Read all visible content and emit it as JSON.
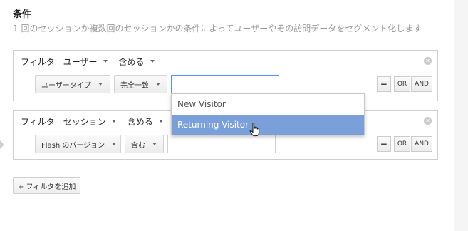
{
  "section": {
    "title": "条件",
    "description": "1 回のセッションか複数回のセッションかの条件によってユーザーやその訪問データをセグメント化します"
  },
  "filters": [
    {
      "label": "フィルタ",
      "scope": "ユーザー",
      "mode": "含める",
      "dimension": "ユーザータイプ",
      "operator": "完全一致",
      "value": "",
      "remove_icon": "close-circle-icon"
    },
    {
      "label": "フィルタ",
      "scope": "セッション",
      "mode": "含める",
      "dimension": "Flash のバージョン",
      "operator": "含む",
      "value": "",
      "remove_icon": "close-circle-icon"
    }
  ],
  "logic": {
    "minus": "−",
    "or": "OR",
    "and": "AND"
  },
  "autocomplete": {
    "items": [
      "New Visitor",
      "Returning Visitor"
    ],
    "highlighted_index": 1,
    "highlight_color": "#7b9fd8"
  },
  "add_filter_label": "+ フィルタを追加",
  "cursor_icon": "hand-pointer-icon"
}
